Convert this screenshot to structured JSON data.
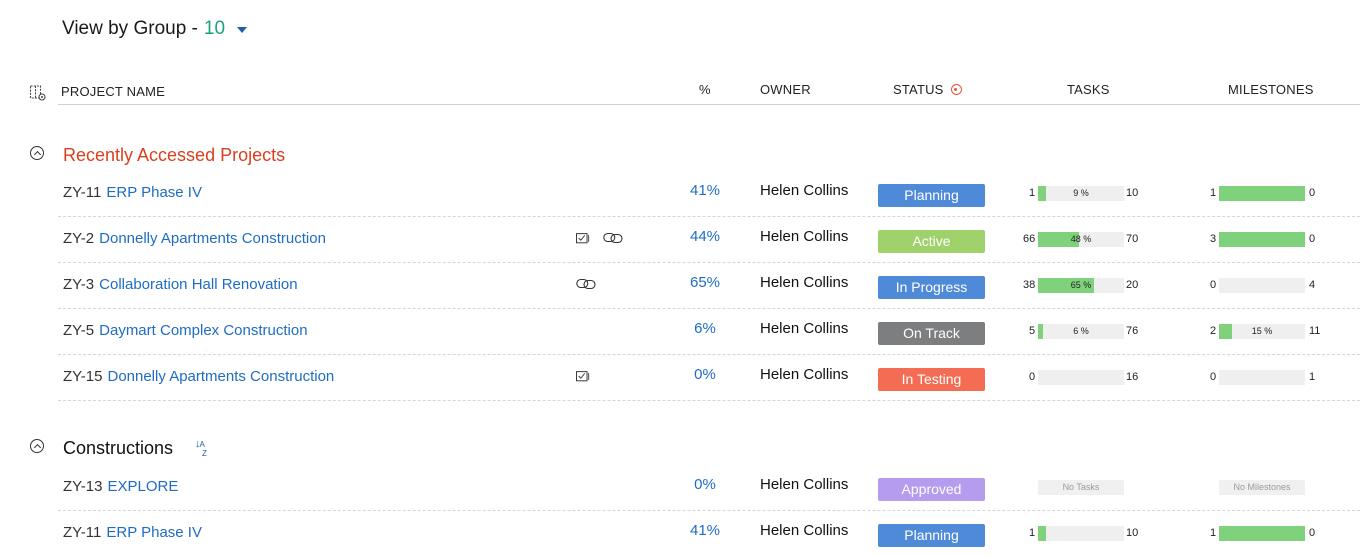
{
  "header": {
    "title": "View by Group -",
    "count": "10"
  },
  "columns": {
    "project": "PROJECT NAME",
    "pct": "%",
    "owner": "OWNER",
    "status": "STATUS",
    "tasks": "TASKS",
    "milestones": "MILESTONES"
  },
  "groups": [
    {
      "title": "Recently Accessed Projects",
      "rows": [
        {
          "code": "ZY-11",
          "name": "ERP Phase IV",
          "icons": [],
          "pct": "41%",
          "owner": "Helen Collins",
          "status": "Planning",
          "status_color": "#4f8ad9",
          "tasks": {
            "left": "1",
            "right": "10",
            "label": "9 %",
            "fraction": 0.09
          },
          "milestones": {
            "left": "1",
            "right": "0",
            "label": "",
            "fraction": 1.0
          }
        },
        {
          "code": "ZY-2",
          "name": "Donnelly Apartments Construction",
          "icons": [
            "calendar",
            "link"
          ],
          "pct": "44%",
          "owner": "Helen Collins",
          "status": "Active",
          "status_color": "#9fd26b",
          "tasks": {
            "left": "66",
            "right": "70",
            "label": "48 %",
            "fraction": 0.48
          },
          "milestones": {
            "left": "3",
            "right": "0",
            "label": "",
            "fraction": 1.0
          }
        },
        {
          "code": "ZY-3",
          "name": "Collaboration Hall Renovation",
          "icons": [
            "link"
          ],
          "pct": "65%",
          "owner": "Helen Collins",
          "status": "In Progress",
          "status_color": "#4f8ad9",
          "tasks": {
            "left": "38",
            "right": "20",
            "label": "65 %",
            "fraction": 0.65
          },
          "milestones": {
            "left": "0",
            "right": "4",
            "label": "",
            "fraction": 0.0
          }
        },
        {
          "code": "ZY-5",
          "name": "Daymart Complex Construction",
          "icons": [],
          "pct": "6%",
          "owner": "Helen Collins",
          "status": "On Track",
          "status_color": "#7d7e80",
          "tasks": {
            "left": "5",
            "right": "76",
            "label": "6 %",
            "fraction": 0.06
          },
          "milestones": {
            "left": "2",
            "right": "11",
            "label": "15 %",
            "fraction": 0.15
          }
        },
        {
          "code": "ZY-15",
          "name": "Donnelly Apartments Construction",
          "icons": [
            "calendar"
          ],
          "pct": "0%",
          "owner": "Helen Collins",
          "status": "In Testing",
          "status_color": "#f56c54",
          "tasks": {
            "left": "0",
            "right": "16",
            "label": "",
            "fraction": 0.0
          },
          "milestones": {
            "left": "0",
            "right": "1",
            "label": "",
            "fraction": 0.0
          }
        }
      ]
    },
    {
      "title": "Constructions",
      "sort_icon": "sort-az-icon",
      "rows": [
        {
          "code": "ZY-13",
          "name": "EXPLORE",
          "icons": [],
          "pct": "0%",
          "owner": "Helen Collins",
          "status": "Approved",
          "status_color": "#b59cee",
          "tasks_empty": "No Tasks",
          "milestones_empty": "No Milestones"
        },
        {
          "code": "ZY-11",
          "name": "ERP Phase IV",
          "icons": [],
          "pct": "41%",
          "owner": "Helen Collins",
          "status": "Planning",
          "status_color": "#4f8ad9",
          "tasks": {
            "left": "1",
            "right": "10",
            "label": "",
            "fraction": 0.09
          },
          "milestones": {
            "left": "1",
            "right": "0",
            "label": "",
            "fraction": 1.0
          }
        }
      ]
    }
  ]
}
